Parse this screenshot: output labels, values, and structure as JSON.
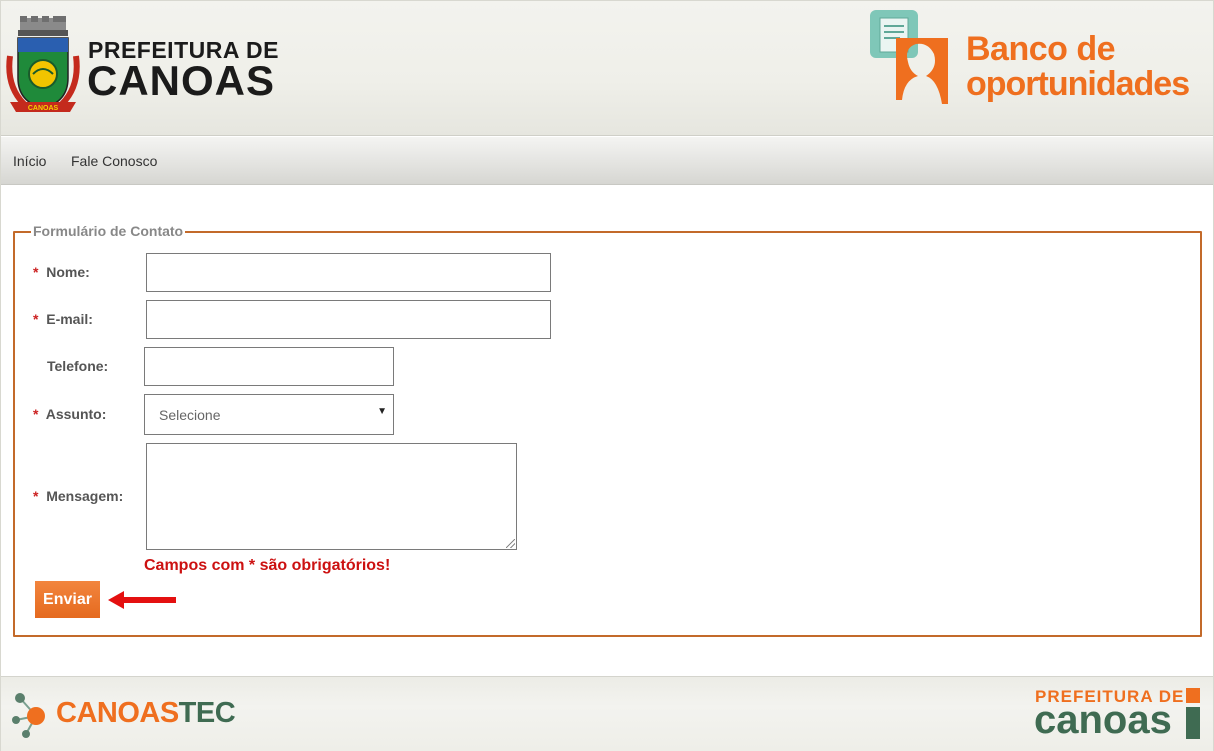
{
  "header": {
    "city_line1": "PREFEITURA DE",
    "city_line2": "CANOAS",
    "crest_banner": "CANOAS",
    "brand_line1": "Banco de",
    "brand_line2": "oportunidades"
  },
  "nav": {
    "items": [
      {
        "label": "Início"
      },
      {
        "label": "Fale Conosco"
      }
    ]
  },
  "form": {
    "legend": "Formulário de Contato",
    "required_mark": "*",
    "fields": {
      "nome": {
        "label": "Nome:",
        "value": ""
      },
      "email": {
        "label": "E-mail:",
        "value": ""
      },
      "telefone": {
        "label": "Telefone:",
        "value": ""
      },
      "assunto": {
        "label": "Assunto:",
        "selected": "Selecione"
      },
      "mensagem": {
        "label": "Mensagem:",
        "value": ""
      }
    },
    "required_message": "Campos com * são obrigatórios!",
    "submit_label": "Enviar"
  },
  "footer": {
    "left_logo_part1": "CANOAS",
    "left_logo_part2": "TEC",
    "right_logo_line1": "PREFEITURA DE",
    "right_logo_line2": "canoas"
  },
  "colors": {
    "accent_orange": "#ef6f1f",
    "fieldset_border": "#c36a2a",
    "required_red": "#cc1111",
    "brand_green": "#3f6b52"
  },
  "icons": [
    "city-crest-icon",
    "banco-oportunidades-icon",
    "dropdown-arrow-icon",
    "red-arrow-icon",
    "molecule-icon"
  ]
}
